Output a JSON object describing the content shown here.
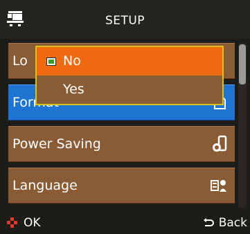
{
  "header": {
    "title": "SETUP",
    "icon": "camcorder-icon"
  },
  "menu": {
    "items": [
      {
        "label": "Lo",
        "icon": "none"
      },
      {
        "label": "Format",
        "icon": "memory-card-icon"
      },
      {
        "label": "Power Saving",
        "icon": "power-saving-icon"
      },
      {
        "label": "Language",
        "icon": "language-icon"
      }
    ],
    "selected_index": 1
  },
  "popup": {
    "options": [
      {
        "label": "No",
        "checked": true
      },
      {
        "label": "Yes",
        "checked": false
      }
    ]
  },
  "footer": {
    "ok_label": "OK",
    "back_label": "Back"
  },
  "colors": {
    "header_bg": "#262421",
    "row_bg": "#8a5c35",
    "selected_bg": "#1f73d1",
    "popup_highlight": "#f06a12",
    "popup_border": "#d9c21a"
  }
}
